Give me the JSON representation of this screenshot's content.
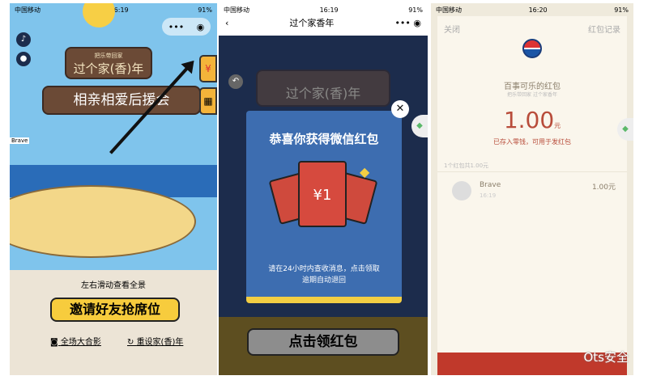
{
  "status_bar": {
    "carrier": "中国移动",
    "battery": "91%",
    "times": [
      "16:19",
      "16:19",
      "16:20"
    ]
  },
  "panel1": {
    "sign_brand": "把乐带回家",
    "sign_title": "过个家(香)年",
    "banner": "相亲相爱后援会",
    "name_tag": "Brave",
    "swipe_hint": "左右滑动查看全景",
    "invite_button": "邀请好友抢席位",
    "photo_link": "全场大合影",
    "reset_link": "重设家(香)年",
    "side_icon_1": "¥"
  },
  "panel2": {
    "nav_title": "过个家香年",
    "modal_title": "恭喜你获得微信红包",
    "amount": "¥1",
    "notice_line1": "请在24小时内查收消息，点击领取",
    "notice_line2": "逾期自动退回",
    "claim_button": "点击领红包"
  },
  "panel3": {
    "close": "关闭",
    "records": "红包记录",
    "sender": "百事可乐的红包",
    "subtitle": "把乐带回家 过个家香年",
    "amount": "1.00",
    "unit": "元",
    "stored_note": "已存入零钱，可用于发红包",
    "summary": "1个红包共1.00元",
    "recipient": "Brave",
    "recipient_time": "16:19",
    "recipient_amount": "1.00元"
  },
  "watermark": "Ots安全"
}
